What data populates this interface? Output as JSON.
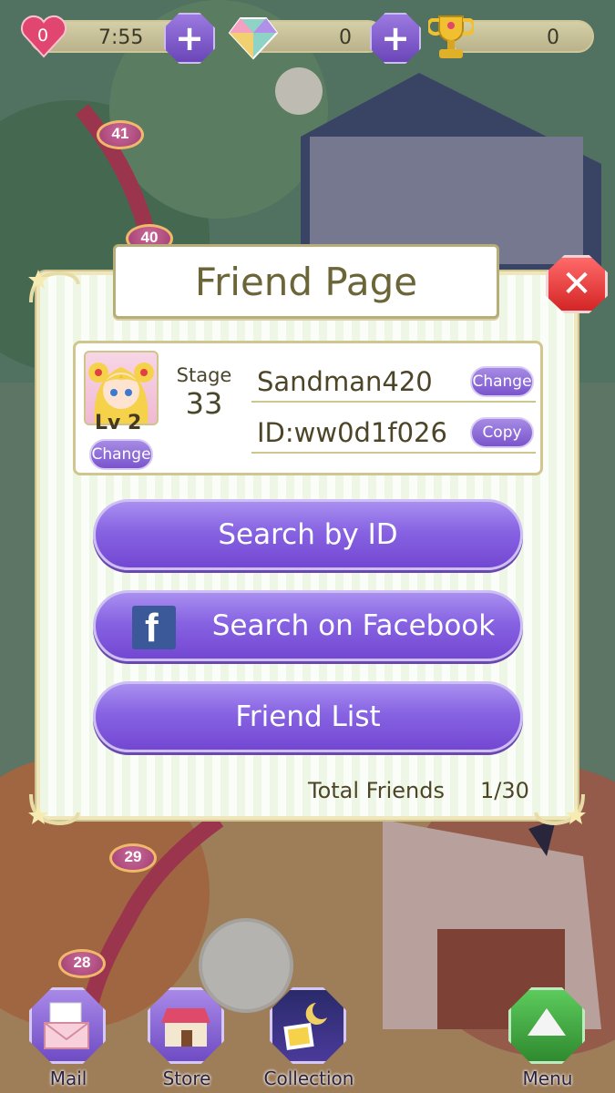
{
  "hud": {
    "hearts": "0",
    "timer": "7:55",
    "gems": "0",
    "trophies": "0",
    "plus_glyph": "+"
  },
  "map": {
    "stages": [
      "41",
      "40",
      "29",
      "28"
    ]
  },
  "dialog": {
    "title": "Friend Page",
    "close_glyph": "✕",
    "profile": {
      "level": "Lv 2",
      "avatar_change_label": "Change",
      "stage_label": "Stage",
      "stage_value": "33",
      "username": "Sandman420",
      "username_change_label": "Change",
      "user_id": "ID:ww0d1f026",
      "copy_label": "Copy"
    },
    "buttons": {
      "search_by_id": "Search by ID",
      "search_facebook": "Search on Facebook",
      "friend_list": "Friend List",
      "facebook_glyph": "f"
    },
    "total_friends_label": "Total Friends",
    "total_friends_value": "1/30"
  },
  "nav": {
    "mail": "Mail",
    "store": "Store",
    "collection": "Collection",
    "menu": "Menu"
  },
  "colors": {
    "accent_purple": "#7a54cc",
    "close_red": "#d42525",
    "facebook_blue": "#3b5998",
    "menu_green": "#3a9c3a"
  }
}
